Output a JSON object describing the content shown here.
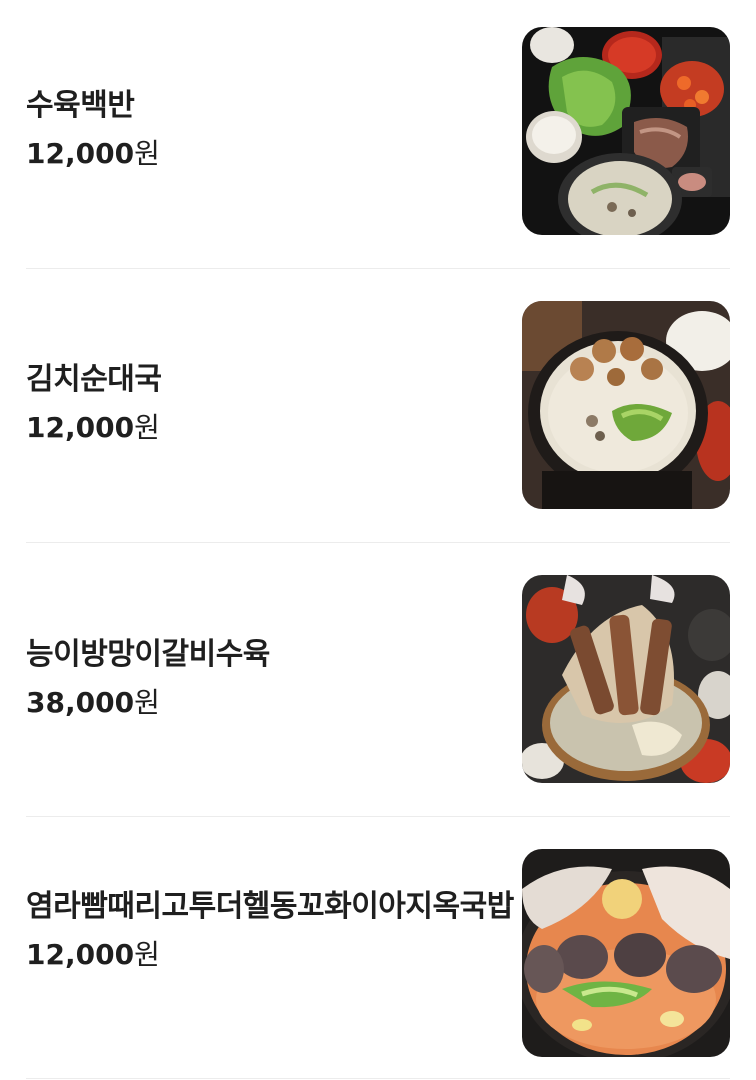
{
  "menu": {
    "items": [
      {
        "name": "수육백반",
        "price_number": "12,000",
        "price_unit": "원",
        "image": "suyuk-baekban-photo"
      },
      {
        "name": "김치순대국",
        "price_number": "12,000",
        "price_unit": "원",
        "image": "kimchi-sundae-guk-photo"
      },
      {
        "name": "능이방망이갈비수육",
        "price_number": "38,000",
        "price_unit": "원",
        "image": "galbi-suyuk-photo"
      },
      {
        "name": "염라빰때리고투더헬동꼬화이아지옥국밥",
        "price_number": "12,000",
        "price_unit": "원",
        "image": "hell-gukbap-photo"
      }
    ]
  },
  "colors": {
    "text": "#1f1f1f",
    "divider": "#ececec",
    "background": "#ffffff"
  }
}
